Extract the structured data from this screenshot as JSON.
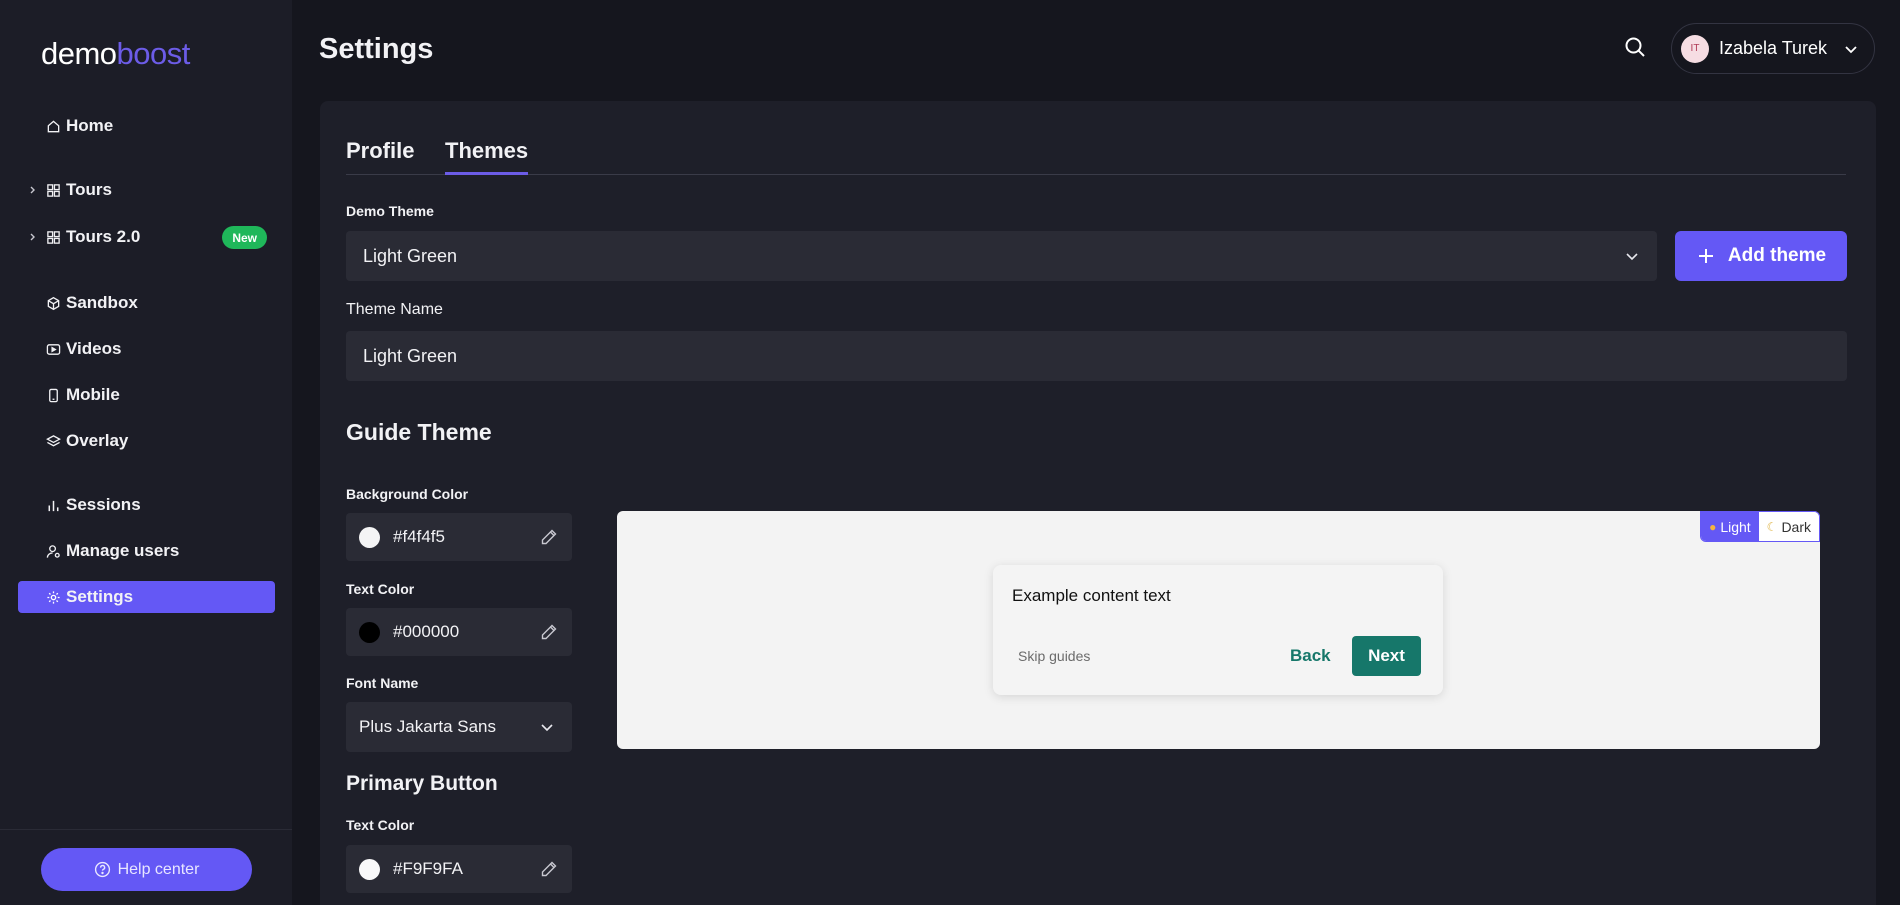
{
  "app": {
    "logo_part1": "demo",
    "logo_part2": "boost",
    "page_title": "Settings"
  },
  "sidebar": {
    "items": [
      {
        "label": "Home",
        "icon": "home-icon"
      },
      {
        "label": "Tours",
        "icon": "grid-icon"
      },
      {
        "label": "Tours 2.0",
        "icon": "grid-icon",
        "badge": "New"
      },
      {
        "label": "Sandbox",
        "icon": "cube-icon"
      },
      {
        "label": "Videos",
        "icon": "video-icon"
      },
      {
        "label": "Mobile",
        "icon": "mobile-icon"
      },
      {
        "label": "Overlay",
        "icon": "layers-icon"
      },
      {
        "label": "Sessions",
        "icon": "bar-chart-icon"
      },
      {
        "label": "Manage users",
        "icon": "user-gear-icon"
      },
      {
        "label": "Settings",
        "icon": "gear-icon",
        "active": true
      }
    ],
    "help_label": "Help center"
  },
  "header": {
    "user_initials": "IT",
    "user_name": "Izabela Turek"
  },
  "tabs": [
    {
      "label": "Profile",
      "active": false
    },
    {
      "label": "Themes",
      "active": true
    }
  ],
  "form": {
    "demo_theme_label": "Demo Theme",
    "demo_theme_value": "Light Green",
    "add_theme_label": "Add theme",
    "theme_name_label": "Theme Name",
    "theme_name_value": "Light Green",
    "guide_theme_title": "Guide Theme",
    "bg_color_label": "Background Color",
    "bg_color_value": "#f4f4f5",
    "text_color_label": "Text Color",
    "text_color_value": "#000000",
    "font_name_label": "Font Name",
    "font_name_value": "Plus Jakarta Sans",
    "primary_button_title": "Primary Button",
    "primary_text_color_label": "Text Color",
    "primary_text_color_value": "#F9F9FA"
  },
  "preview": {
    "mode_light": "Light",
    "mode_dark": "Dark",
    "content_text": "Example content text",
    "skip_label": "Skip guides",
    "back_label": "Back",
    "next_label": "Next",
    "accent_color": "#16776a"
  },
  "colors": {
    "brand": "#6458f5",
    "badge_green": "#1fb75a",
    "background": "#15161e"
  }
}
